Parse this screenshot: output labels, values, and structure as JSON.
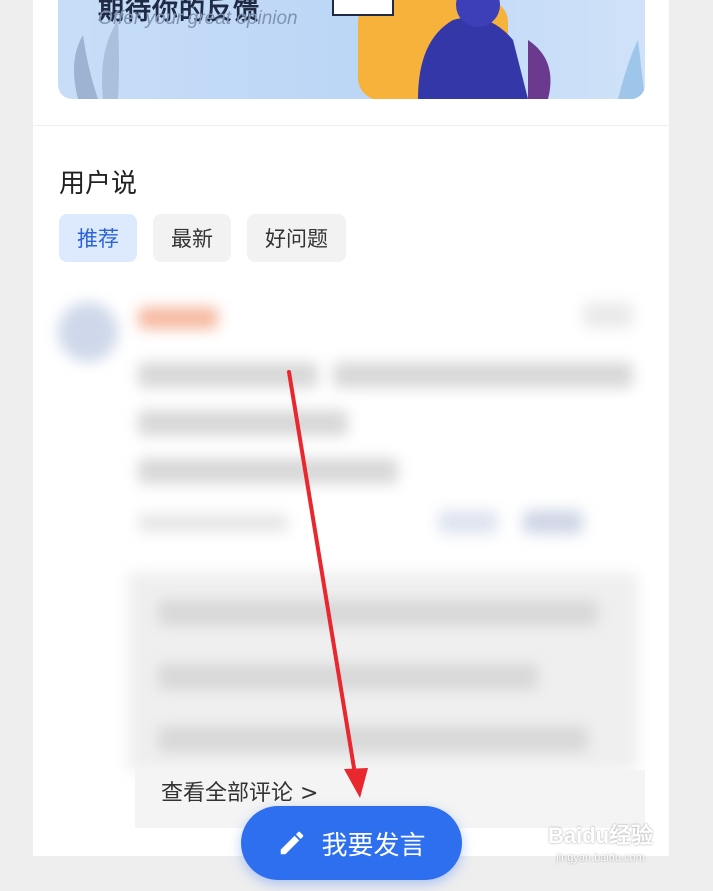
{
  "banner": {
    "title": "期待你的反馈",
    "subtitle": "Offer your great opinion"
  },
  "section": {
    "title": "用户说"
  },
  "tabs": [
    {
      "label": "推荐",
      "active": true
    },
    {
      "label": "最新",
      "active": false
    },
    {
      "label": "好问题",
      "active": false
    }
  ],
  "comments": {
    "view_all": "查看全部评论 >"
  },
  "post_button": {
    "label": "我要发言",
    "icon": "pencil-icon"
  },
  "watermark": {
    "brand": "Baidu经验",
    "url": "jingyan.baidu.com"
  },
  "colors": {
    "accent": "#2e6ff0",
    "tab_active_bg": "#dde9fd",
    "tab_active_text": "#2a63d8",
    "arrow": "#e8272f"
  }
}
